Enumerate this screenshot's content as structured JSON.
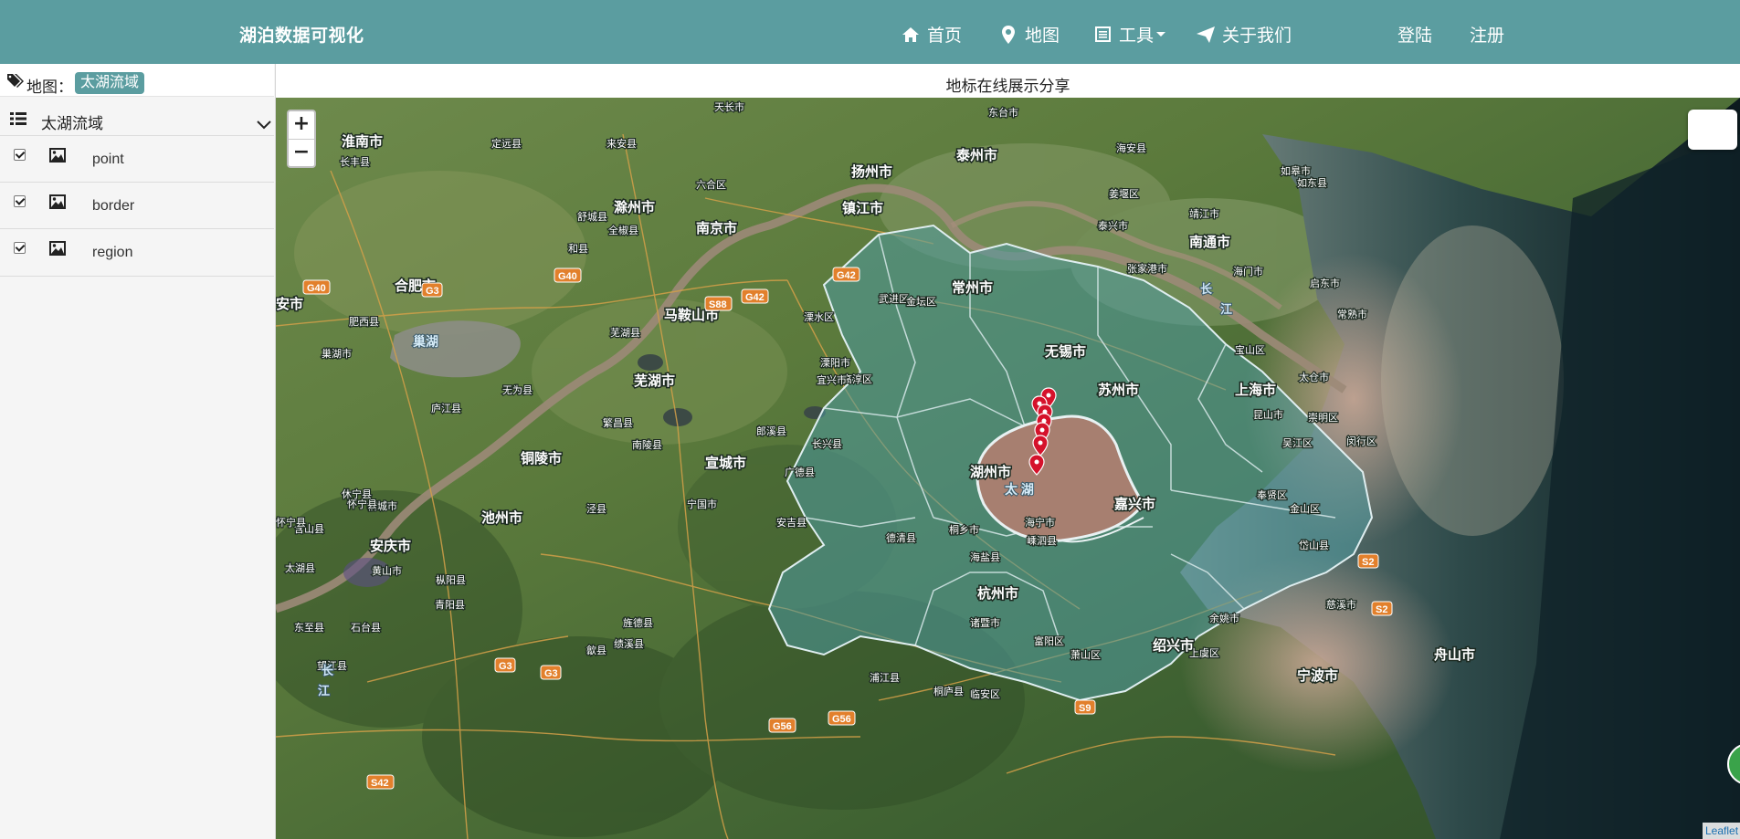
{
  "nav": {
    "brand": "湖泊数据可视化",
    "items": [
      {
        "label": "首页",
        "icon": "home-icon"
      },
      {
        "label": "地图",
        "icon": "map-marker-icon"
      },
      {
        "label": "工具",
        "icon": "list-alt-icon"
      },
      {
        "label": "关于我们",
        "icon": "send-icon"
      }
    ],
    "login": "登陆",
    "register": "注册"
  },
  "sidebar": {
    "map_label": "地图：",
    "map_name": "太湖流域",
    "group_name": "太湖流域",
    "layers": [
      "point",
      "border",
      "region"
    ]
  },
  "content": {
    "title": "地标在线展示分享",
    "attribution": "Leaflet"
  },
  "map": {
    "controls": {
      "zoom_in": "+",
      "zoom_out": "−"
    },
    "cities": [
      "淮南市",
      "滁州市",
      "扬州市",
      "泰州市",
      "镇江市",
      "南京市",
      "南通市",
      "合肥市",
      "马鞍山市",
      "常州市",
      "无锡市",
      "苏州市",
      "上海市",
      "芜湖市",
      "铜陵市",
      "宣城市",
      "湖州市",
      "嘉兴市",
      "池州市",
      "安庆市",
      "杭州市",
      "绍兴市",
      "宁波市",
      "舟山市",
      "安市"
    ],
    "counties": [
      "天长市",
      "来安县",
      "定远县",
      "六合区",
      "全椒县",
      "东台市",
      "姜堰区",
      "泰兴市",
      "海安县",
      "如皋市",
      "如东县",
      "靖江市",
      "张家港市",
      "海门市",
      "启东市",
      "常熟市",
      "太仓市",
      "崇明区",
      "宝山区",
      "昆山市",
      "吴江区",
      "闵行区",
      "奉贤区",
      "金山区",
      "武进区",
      "金坛区",
      "溧水区",
      "高淳区",
      "溧阳市",
      "宜兴市",
      "长兴县",
      "广德县",
      "郎溪县",
      "宁国市",
      "安吉县",
      "德清县",
      "桐乡市",
      "海宁市",
      "海盐县",
      "嵊泗县",
      "岱山县",
      "慈溪市",
      "余姚市",
      "上虞区",
      "萧山区",
      "富阳区",
      "临安区",
      "桐庐县",
      "诸暨市",
      "浦江县",
      "绩溪县",
      "歙县",
      "旌德县",
      "泾县",
      "南陵县",
      "繁昌县",
      "芜湖县",
      "无为县",
      "庐江县",
      "肥西县",
      "巢湖市",
      "舒城县",
      "和县",
      "含山县",
      "桐城市",
      "怀宁县",
      "枞阳县",
      "青阳县",
      "石台县",
      "东至县",
      "望江县",
      "太湖县",
      "怀宁县",
      "休宁县",
      "黄山市",
      "长丰县"
    ],
    "lake_labels": [
      "巢湖",
      "太 湖"
    ],
    "river_labels": [
      "长",
      "江",
      "长",
      "江"
    ],
    "highway_labels": [
      "G40",
      "G40",
      "G3",
      "G42",
      "S88",
      "G42",
      "G3",
      "G3",
      "G56",
      "G56",
      "S9",
      "S2",
      "S2",
      "S42"
    ],
    "markers": 7
  }
}
